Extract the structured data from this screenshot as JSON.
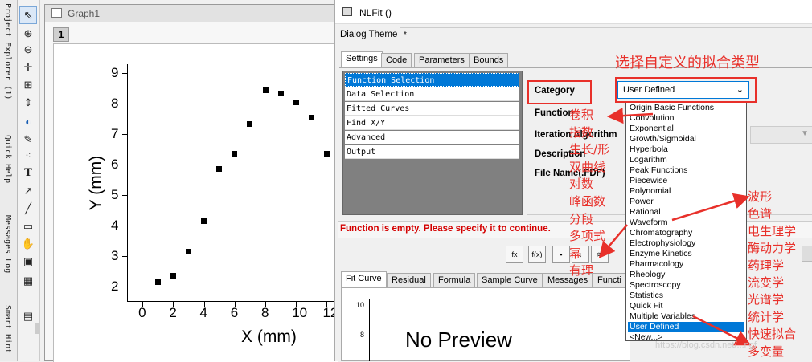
{
  "side_panels": {
    "project_explorer": "Project Explorer (1)",
    "quick_help": "Quick Help",
    "messages_log": "Messages Log",
    "smart_hint": "Smart Hint"
  },
  "toolbar_icons": [
    "pointer-icon",
    "zoom-icon",
    "zoom-out-icon",
    "data-reader-icon",
    "region-icon",
    "scale-icon",
    "mask-icon",
    "draw-data-icon",
    "scatter-select-icon",
    "text-icon",
    "arrow-icon",
    "line-icon",
    "rectangle-icon",
    "pan-hand-icon",
    "insert-equation-icon",
    "insert-graph-icon",
    "object-icon"
  ],
  "graph": {
    "title": "Graph1",
    "layer": "1",
    "chart_data": {
      "type": "scatter",
      "xlabel": "X (mm)",
      "ylabel": "Y (mm)",
      "xlim": [
        -1,
        12.5
      ],
      "ylim": [
        1.5,
        9.3
      ],
      "xticks": [
        "0",
        "2",
        "4",
        "6",
        "8",
        "10",
        "12"
      ],
      "yticks": [
        "2",
        "3",
        "4",
        "5",
        "6",
        "7",
        "8",
        "9"
      ],
      "x": [
        1,
        2,
        3,
        4,
        5,
        6,
        7,
        8,
        9,
        10,
        11,
        12
      ],
      "y": [
        2.15,
        2.35,
        3.15,
        4.15,
        5.85,
        6.35,
        7.35,
        8.45,
        8.35,
        8.05,
        7.55,
        6.35
      ]
    }
  },
  "dialog": {
    "title": "NLFit ()",
    "theme_label": "Dialog Theme",
    "theme_value": "*",
    "tabs": [
      "Settings",
      "Code",
      "Parameters",
      "Bounds"
    ],
    "tree": [
      "Function Selection",
      "Data Selection",
      "Fitted Curves",
      "Find X/Y",
      "Advanced",
      "Output"
    ],
    "labels": {
      "category": "Category",
      "function": "Function",
      "iteration": "Iteration Algorithm",
      "description": "Description",
      "file_name": "File Name(.FDF)"
    },
    "category_value": "User Defined",
    "category_options": [
      "Origin Basic Functions",
      "Convolution",
      "Exponential",
      "Growth/Sigmoidal",
      "Hyperbola",
      "Logarithm",
      "Peak Functions",
      "Piecewise",
      "Polynomial",
      "Power",
      "Rational",
      "Waveform",
      "Chromatography",
      "Electrophysiology",
      "Enzyme Kinetics",
      "Pharmacology",
      "Rheology",
      "Spectroscopy",
      "Statistics",
      "Quick Fit",
      "Multiple Variables",
      "User Defined",
      "<New...>"
    ],
    "error": "Function is empty. Please specify it to continue.",
    "bottom_tabs": [
      "Fit Curve",
      "Residual",
      "Formula",
      "Sample Curve",
      "Messages",
      "Functi"
    ],
    "preview": {
      "text": "No Preview",
      "ytick_top": "10",
      "ytick_mid": "8"
    }
  },
  "annotations": {
    "title": "选择自定义的拟合类型",
    "left_list": [
      "卷积",
      "指数",
      "生长/形",
      "双曲线",
      "对数",
      "峰函数",
      "分段",
      "多项式",
      "幂",
      "有理"
    ],
    "right_list": [
      "波形",
      "色谱",
      "电生理学",
      "酶动力学",
      "药理学",
      "流变学",
      "光谱学",
      "统计学",
      "快速拟合",
      "多变量"
    ]
  },
  "watermark": "https://blog.csdn.net/...ngf",
  "colors": {
    "accent": "#0078d7",
    "annotation": "#e8302a",
    "error": "#d40000"
  }
}
